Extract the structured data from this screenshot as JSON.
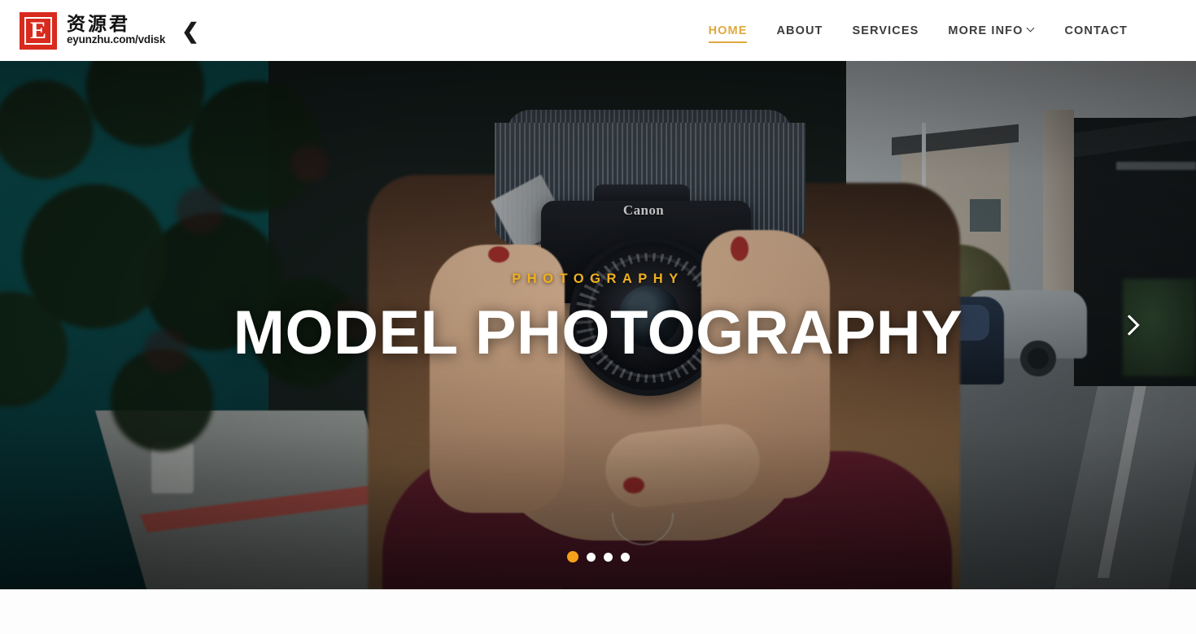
{
  "header": {
    "logo": {
      "mark_letter": "E",
      "cn_name": "资源君",
      "url": "eyunzhu.com/vdisk",
      "toggle_icon": "❮"
    },
    "nav": [
      {
        "label": "HOME",
        "active": true,
        "has_caret": false
      },
      {
        "label": "ABOUT",
        "active": false,
        "has_caret": false
      },
      {
        "label": "SERVICES",
        "active": false,
        "has_caret": false
      },
      {
        "label": "MORE INFO",
        "active": false,
        "has_caret": true
      },
      {
        "label": "CONTACT",
        "active": false,
        "has_caret": false
      }
    ]
  },
  "hero": {
    "eyebrow": "PHOTOGRAPHY",
    "title": "MODEL PHOTOGRAPHY",
    "next_label": "›",
    "camera_brand": "Canon",
    "slides": [
      {
        "index": 1,
        "active": true
      },
      {
        "index": 2,
        "active": false
      },
      {
        "index": 3,
        "active": false
      },
      {
        "index": 4,
        "active": false
      }
    ]
  },
  "colors": {
    "accent_gold": "#e0a93d",
    "eyebrow_gold": "#f0b01f",
    "dot_active": "#f5a11b",
    "logo_red": "#d82b1e",
    "nav_text": "#3c3c3c",
    "header_bg": "#ffffff",
    "page_bg": "#fdfdfd"
  }
}
